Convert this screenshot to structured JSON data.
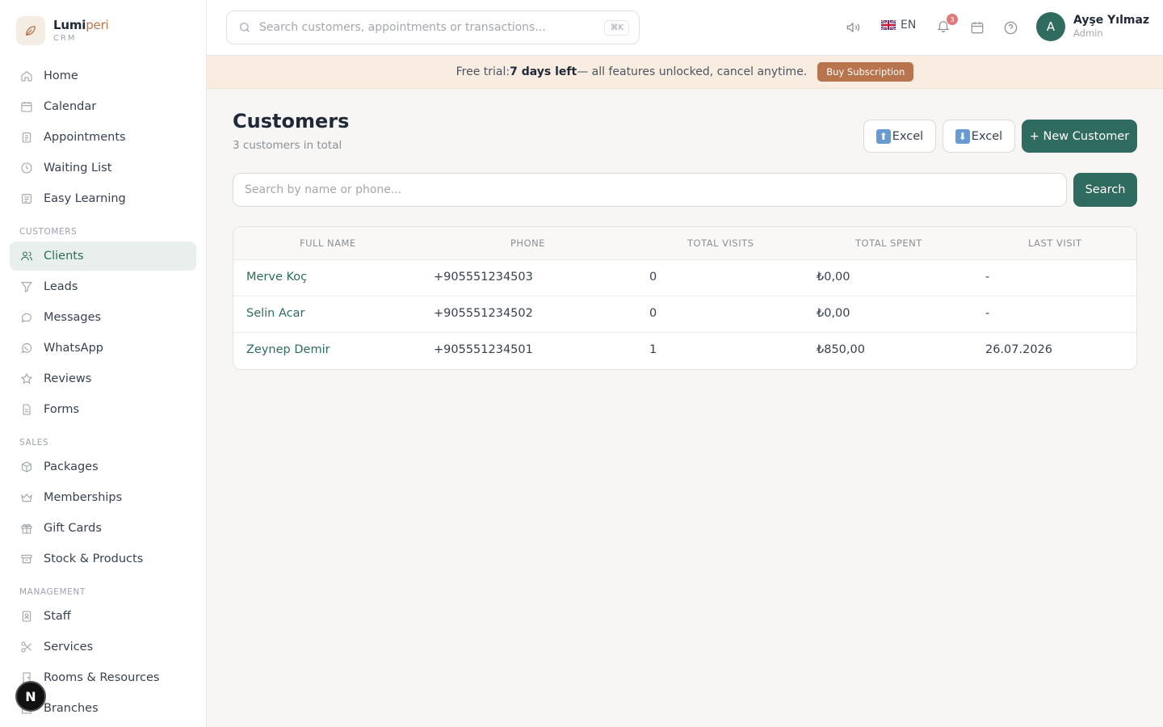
{
  "brand": {
    "name_main": "Lumi",
    "name_accent": "peri",
    "sub": "CRM"
  },
  "sidebar": {
    "top_items": [
      {
        "label": "Home",
        "icon": "home-icon"
      },
      {
        "label": "Calendar",
        "icon": "calendar-icon"
      },
      {
        "label": "Appointments",
        "icon": "clipboard-icon"
      },
      {
        "label": "Waiting List",
        "icon": "clock-icon"
      },
      {
        "label": "Easy Learning",
        "icon": "notes-icon"
      }
    ],
    "customers_section": "CUSTOMERS",
    "customers_items": [
      {
        "label": "Clients",
        "icon": "users-icon",
        "active": true
      },
      {
        "label": "Leads",
        "icon": "filter-icon"
      },
      {
        "label": "Messages",
        "icon": "chat-icon"
      },
      {
        "label": "WhatsApp",
        "icon": "whatsapp-icon"
      },
      {
        "label": "Reviews",
        "icon": "star-icon"
      },
      {
        "label": "Forms",
        "icon": "document-icon"
      }
    ],
    "sales_section": "SALES",
    "sales_items": [
      {
        "label": "Packages",
        "icon": "box-icon"
      },
      {
        "label": "Memberships",
        "icon": "crown-icon"
      },
      {
        "label": "Gift Cards",
        "icon": "gift-icon"
      },
      {
        "label": "Stock & Products",
        "icon": "archive-icon"
      }
    ],
    "management_section": "MANAGEMENT",
    "management_items": [
      {
        "label": "Staff",
        "icon": "id-badge-icon"
      },
      {
        "label": "Services",
        "icon": "scissors-icon"
      },
      {
        "label": "Rooms & Resources",
        "icon": "door-icon"
      },
      {
        "label": "Branches",
        "icon": "building-icon"
      }
    ]
  },
  "topbar": {
    "search_placeholder": "Search customers, appointments or transactions...",
    "shortcut": "⌘K",
    "language": "EN",
    "notification_count": "3",
    "user": {
      "initial": "A",
      "name": "Ayşe Yılmaz",
      "role": "Admin"
    }
  },
  "trial": {
    "prefix": "Free trial: ",
    "days": "7 days left",
    "suffix": " — all features unlocked, cancel anytime.",
    "button": "Buy Subscription"
  },
  "page": {
    "title": "Customers",
    "subtitle": "3 customers in total",
    "import_label": "Excel",
    "export_label": "Excel",
    "new_customer_label": "+ New Customer",
    "search_placeholder": "Search by name or phone...",
    "search_button": "Search"
  },
  "table": {
    "headers": [
      "FULL NAME",
      "PHONE",
      "TOTAL VISITS",
      "TOTAL SPENT",
      "LAST VISIT"
    ],
    "rows": [
      {
        "name": "Merve Koç",
        "phone": "+905551234503",
        "visits": "0",
        "spent": "₺0,00",
        "last": "-"
      },
      {
        "name": "Selin Acar",
        "phone": "+905551234502",
        "visits": "0",
        "spent": "₺0,00",
        "last": "-"
      },
      {
        "name": "Zeynep Demir",
        "phone": "+905551234501",
        "visits": "1",
        "spent": "₺850,00",
        "last": "26.07.2026"
      }
    ]
  },
  "colors": {
    "primary": "#2f6b5e",
    "accent": "#b8744c",
    "trial_bg": "#f8ede0"
  }
}
